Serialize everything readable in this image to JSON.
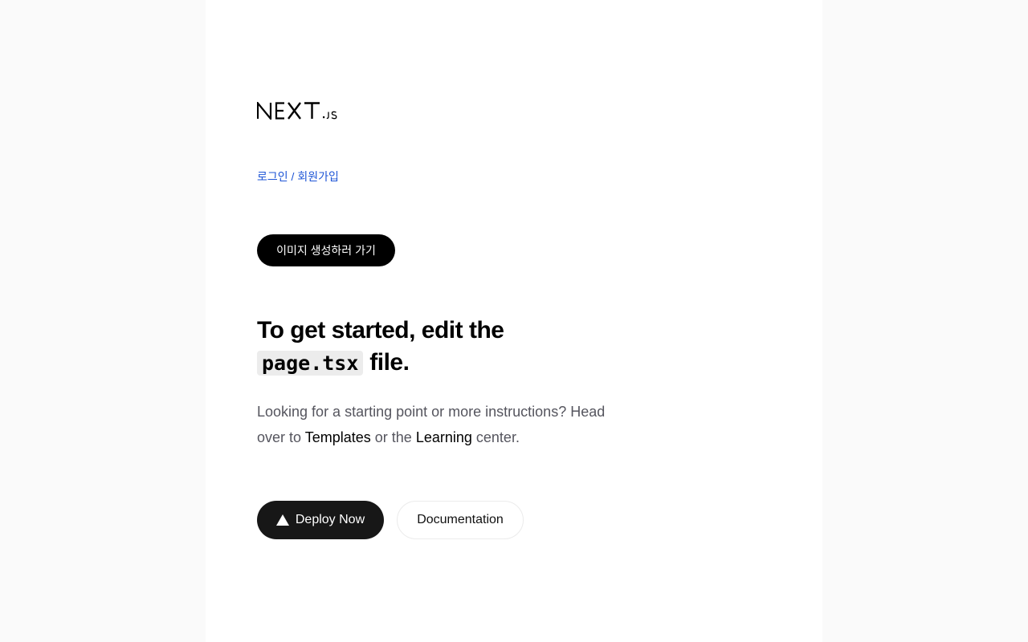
{
  "logo": {
    "name": "nextjs-logo",
    "text": "NEXT.js"
  },
  "auth": {
    "login_label": "로그인",
    "separator": "/",
    "signup_label": "회원가입",
    "link_color": "#1e55d6"
  },
  "generate_button": {
    "label": "이미지 생성하러 가기"
  },
  "headline": {
    "line1": "To get started, edit the",
    "code": "page.tsx",
    "line2_suffix": "file."
  },
  "description": {
    "part1": "Looking for a starting point or more instructions? Head over to",
    "templates_link": "Templates",
    "part2": "or the",
    "learning_link": "Learning",
    "part3": "center."
  },
  "actions": {
    "deploy_label": "Deploy Now",
    "deploy_icon": "vercel-triangle-icon",
    "docs_label": "Documentation"
  }
}
